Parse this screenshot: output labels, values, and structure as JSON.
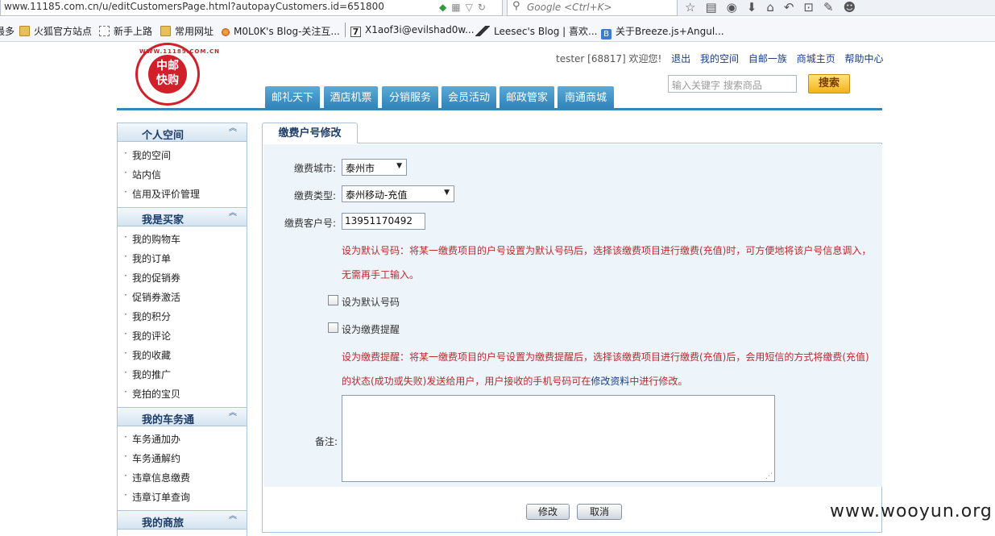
{
  "browser": {
    "url": "www.11185.com.cn/u/editCustomersPage.html?autopayCustomers.id=651800",
    "search_placeholder": "Google <Ctrl+K>",
    "bookmarks": [
      {
        "label": "最多",
        "icon": "none"
      },
      {
        "label": "火狐官方站点",
        "icon": "folder-icon"
      },
      {
        "label": "新手上路",
        "icon": "dashed-page-icon"
      },
      {
        "label": "常用网址",
        "icon": "folder-icon"
      },
      {
        "label": "M0L0K's Blog-关注互...",
        "icon": "flame-icon"
      },
      {
        "label": "X1aof3i@evilshad0w...",
        "icon": "seven-icon"
      },
      {
        "label": "Leesec's Blog | 喜欢...",
        "icon": "leesec-icon"
      },
      {
        "label": "关于Breeze.js+Angul...",
        "icon": "breeze-icon"
      }
    ]
  },
  "header": {
    "logo_top": "WWW.11185.COM.CN",
    "logo_text_1": "中邮",
    "logo_text_2": "快购",
    "greeting": "tester [68817] 欢迎您!",
    "links": [
      "退出",
      "我的空间",
      "自邮一族",
      "商城主页",
      "帮助中心"
    ],
    "search_placeholder": "输入关键字 搜索商品",
    "search_button": "搜索",
    "nav_tabs": [
      "邮礼天下",
      "酒店机票",
      "分销服务",
      "会员活动",
      "邮政管家",
      "南通商城"
    ]
  },
  "sidebar": {
    "sections": [
      {
        "title": "个人空间",
        "items": [
          "我的空间",
          "站内信",
          "信用及评价管理"
        ]
      },
      {
        "title": "我是买家",
        "items": [
          "我的购物车",
          "我的订单",
          "我的促销券",
          "促销券激活",
          "我的积分",
          "我的评论",
          "我的收藏",
          "我的推广",
          "竞拍的宝贝"
        ]
      },
      {
        "title": "我的车务通",
        "items": [
          "车务通加办",
          "车务通解约",
          "违章信息缴费",
          "违章订单查询"
        ]
      },
      {
        "title": "我的商旅",
        "items": []
      }
    ]
  },
  "form": {
    "tab_title": "缴费户号修改",
    "city_label": "缴费城市:",
    "city_value": "泰州市",
    "type_label": "缴费类型:",
    "type_value": "泰州移动-充值",
    "account_label": "缴费客户号:",
    "account_value": "13951170492",
    "default_note_line1": "设为默认号码：将某一缴费项目的户号设置为默认号码后，选择该缴费项目进行缴费(充值)时，可方便地将该户号信息调入，",
    "default_note_line2": "无需再手工输入。",
    "default_checkbox_label": "设为默认号码",
    "reminder_checkbox_label": "设为缴费提醒",
    "reminder_note_line1": "设为缴费提醒：将某一缴费项目的户号设置为缴费提醒后，选择该缴费项目进行缴费(充值)后，会用短信的方式将缴费(充值)",
    "reminder_note_line2_a": "的状态(成功或失败)发送给用户，用户接收的手机号码可在",
    "reminder_note_link": "修改资料",
    "reminder_note_line2_b": "中进行修改。",
    "remark_label": "备注:",
    "remark_value": "",
    "submit_button": "修改",
    "cancel_button": "取消"
  },
  "watermark": "www.wooyun.org"
}
